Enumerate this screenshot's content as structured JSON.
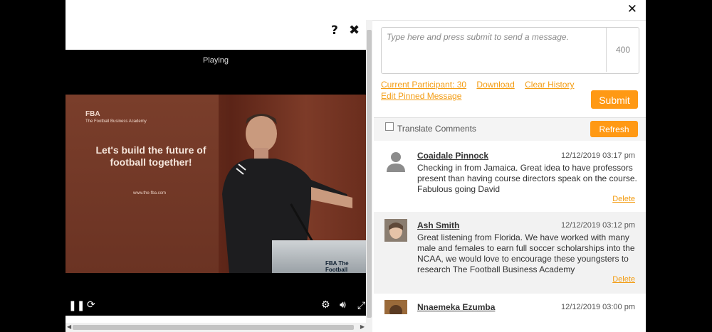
{
  "window": {
    "close_label": "✕"
  },
  "video": {
    "help_label": "?",
    "close_label": "✖",
    "status": "Playing",
    "banner": {
      "logo_main": "FBA",
      "logo_sub": "The Football Business Academy",
      "headline": "Let's build the future of football together!",
      "url": "www.the-fba.com"
    },
    "lectern_logo": "FBA The Football"
  },
  "chat": {
    "input_placeholder": "Type here and press submit to send a message.",
    "char_limit": "400",
    "current_participant": "Current Participant: 30",
    "download": "Download",
    "clear_history": "Clear History",
    "edit_pinned": "Edit Pinned Message",
    "submit": "Submit",
    "translate_label": "Translate Comments",
    "translate_checked": false,
    "refresh": "Refresh",
    "delete_label": "Delete",
    "messages": [
      {
        "name": "Coaidale Pinnock",
        "time": "12/12/2019 03:17 pm",
        "text": "Checking in from Jamaica. Great idea to have professors present than having course directors speak on the course. Fabulous going David"
      },
      {
        "name": "Ash Smith",
        "time": "12/12/2019 03:12 pm",
        "text": "Great listening from Florida. We have worked with many male and females to earn full soccer scholarships into the NCAA, we would love to encourage these youngsters to research The Football Business Academy"
      },
      {
        "name": "Nnaemeka Ezumba",
        "time": "12/12/2019 03:00 pm",
        "text": ""
      }
    ]
  },
  "colors": {
    "accent": "#ff9914",
    "link": "#f39c12"
  }
}
